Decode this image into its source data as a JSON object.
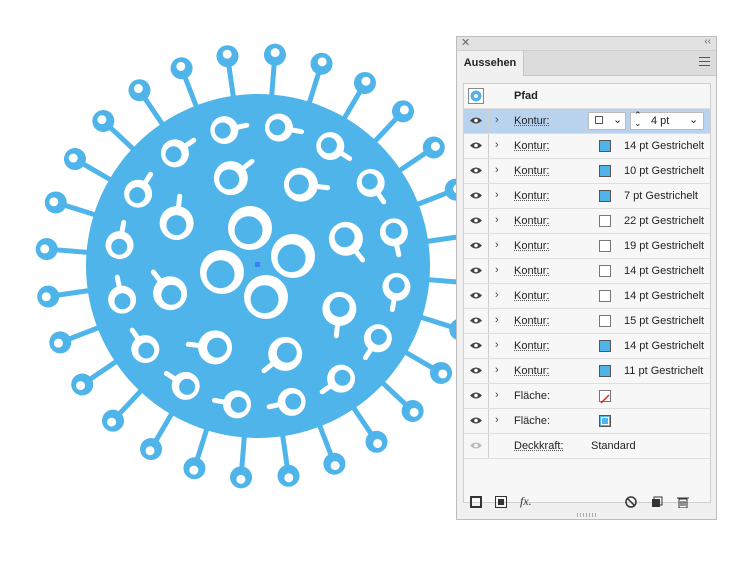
{
  "colors": {
    "virus_blue": "#4fb4e9",
    "selection": "#b9d3ee"
  },
  "panel": {
    "title": "Aussehen",
    "header": "Pfad",
    "selected_row": {
      "attr": "Kontur:",
      "stroke_weight": "4 pt"
    },
    "rows": [
      {
        "attr": "Kontur:",
        "swatch": "blue",
        "value": "14 pt Gestrichelt"
      },
      {
        "attr": "Kontur:",
        "swatch": "blue",
        "value": "10 pt Gestrichelt"
      },
      {
        "attr": "Kontur:",
        "swatch": "blue",
        "value": "7 pt Gestrichelt"
      },
      {
        "attr": "Kontur:",
        "swatch": "none",
        "value": "22 pt Gestrichelt"
      },
      {
        "attr": "Kontur:",
        "swatch": "none",
        "value": "19 pt Gestrichelt"
      },
      {
        "attr": "Kontur:",
        "swatch": "none",
        "value": "14 pt Gestrichelt"
      },
      {
        "attr": "Kontur:",
        "swatch": "none",
        "value": "14 pt Gestrichelt"
      },
      {
        "attr": "Kontur:",
        "swatch": "none",
        "value": "15 pt Gestrichelt"
      },
      {
        "attr": "Kontur:",
        "swatch": "blue",
        "value": "14 pt Gestrichelt"
      },
      {
        "attr": "Kontur:",
        "swatch": "blue",
        "value": "11 pt Gestrichelt"
      }
    ],
    "fill_rows": [
      {
        "attr": "Fläche:",
        "swatch": "none-slash"
      },
      {
        "attr": "Fläche:",
        "swatch": "blue-frame"
      }
    ],
    "opacity_row": {
      "attr": "Deckkraft:",
      "value": "Standard"
    },
    "bottom_icons": [
      "add-stroke-icon",
      "add-fill-icon",
      "fx-icon",
      "clear-icon",
      "duplicate-icon",
      "delete-icon"
    ],
    "fx_label": "fx."
  }
}
